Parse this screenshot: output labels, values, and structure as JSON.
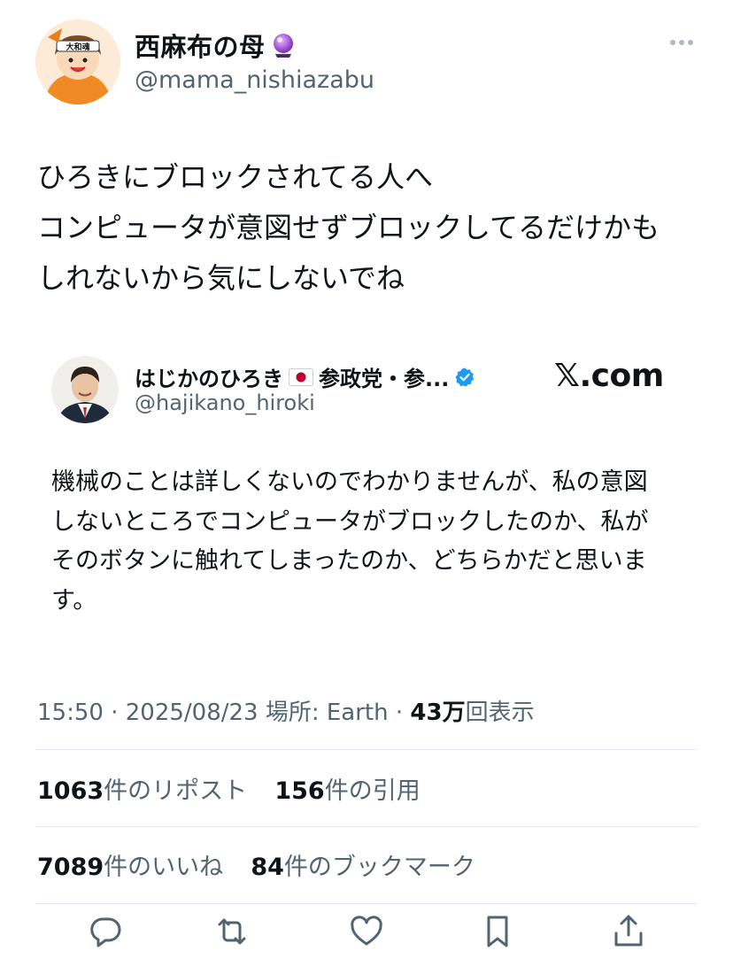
{
  "author": {
    "display_name": "西麻布の母",
    "handle": "@mama_nishiazabu",
    "avatar_banner_text": "大和魂"
  },
  "tweet": {
    "lines": [
      "ひろきにブロックされてる人へ",
      "コンピュータが意図せずブロックしてるだけかも",
      "しれないから気にしないでね"
    ]
  },
  "quote": {
    "display_name": "はじかのひろき",
    "display_name_rest": "参政党・参...",
    "handle": "@hajikano_hiroki",
    "source": "𝕏.com",
    "lines": [
      "機械のことは詳しくないのでわかりませんが、私の意図",
      "しないところでコンピュータがブロックしたのか、私が",
      "そのボタンに触れてしまったのか、どちらかだと思いま",
      "す。"
    ]
  },
  "meta": {
    "time": "15:50",
    "date": "2025/08/23",
    "location": "場所: Earth",
    "views_count": "43万",
    "views_label": "回表示"
  },
  "stats": {
    "reposts_count": "1063",
    "reposts_label": "件のリポスト",
    "quotes_count": "156",
    "quotes_label": "件の引用",
    "likes_count": "7089",
    "likes_label": "件のいいね",
    "bookmarks_count": "84",
    "bookmarks_label": "件のブックマーク"
  },
  "icons": {
    "more": "more-horizontal-icon",
    "crystal_ball": "crystal-ball-emoji",
    "verified": "verified-badge-icon",
    "flag": "japan-flag-icon",
    "reply": "reply-icon",
    "retweet": "retweet-icon",
    "like": "heart-icon",
    "bookmark": "bookmark-icon",
    "share": "share-icon"
  },
  "colors": {
    "text": "#0f1419",
    "secondary": "#536471",
    "verified": "#1d9bf0",
    "divider": "#e1e8ed"
  }
}
